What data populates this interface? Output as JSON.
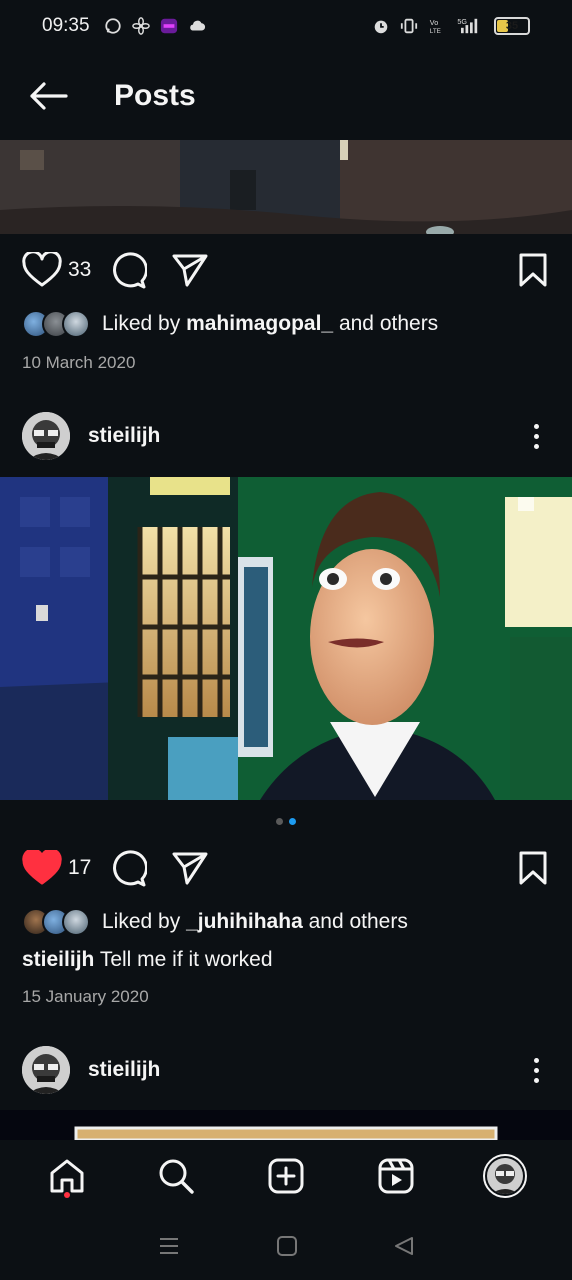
{
  "status_bar": {
    "time": "09:35",
    "battery": "35"
  },
  "header": {
    "title": "Posts"
  },
  "posts": [
    {
      "likes": "33",
      "liked_by_prefix": "Liked by ",
      "liked_by_user": "mahimagopal_",
      "liked_by_suffix": " and others",
      "date": "10 March 2020"
    },
    {
      "username": "stieilijh",
      "likes": "17",
      "liked": true,
      "liked_by_prefix": "Liked by ",
      "liked_by_user": "_juhihihaha",
      "liked_by_suffix": " and others",
      "caption_user": "stieilijh",
      "caption_text": " Tell me if it worked",
      "date": "15 January 2020",
      "carousel_pages": 2,
      "carousel_active": 2
    },
    {
      "username": "stieilijh"
    }
  ],
  "nav": {
    "items": [
      "home-icon",
      "search-icon",
      "create-icon",
      "reels-icon",
      "profile-avatar"
    ]
  },
  "colors": {
    "background": "#0c1014",
    "like_red": "#ff3040",
    "accent_blue": "#1d9bf0"
  }
}
